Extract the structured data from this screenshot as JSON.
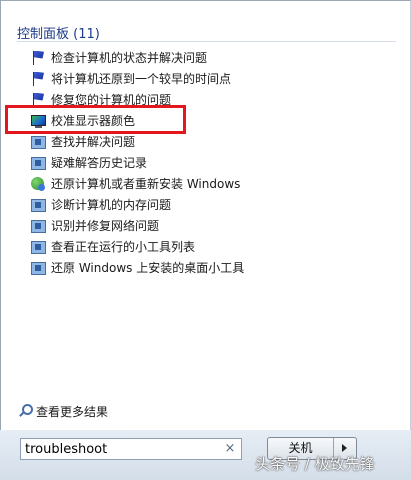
{
  "group": {
    "title": "控制面板 (11)"
  },
  "items": [
    {
      "label": "检查计算机的状态并解决问题",
      "icon": "flag-icon"
    },
    {
      "label": "将计算机还原到一个较早的时间点",
      "icon": "flag-icon"
    },
    {
      "label": "修复您的计算机的问题",
      "icon": "flag-icon"
    },
    {
      "label": "校准显示器颜色",
      "icon": "monitor-color-icon"
    },
    {
      "label": "查找并解决问题",
      "icon": "troubleshoot-icon"
    },
    {
      "label": "疑难解答历史记录",
      "icon": "troubleshoot-icon"
    },
    {
      "label": "还原计算机或者重新安装 Windows",
      "icon": "recovery-icon"
    },
    {
      "label": "诊断计算机的内存问题",
      "icon": "memory-diagnostic-icon"
    },
    {
      "label": "识别并修复网络问题",
      "icon": "network-icon"
    },
    {
      "label": "查看正在运行的小工具列表",
      "icon": "gadget-list-icon"
    },
    {
      "label": "还原 Windows 上安装的桌面小工具",
      "icon": "gadget-restore-icon"
    }
  ],
  "see_more": {
    "label": "查看更多结果"
  },
  "search": {
    "value": "troubleshoot",
    "clear_glyph": "×"
  },
  "shutdown": {
    "label": "关机"
  },
  "watermark": {
    "text": "头条号 / 极致先锋"
  },
  "colors": {
    "accent": "#1e3a8a",
    "highlight_box": "#e4171f"
  }
}
